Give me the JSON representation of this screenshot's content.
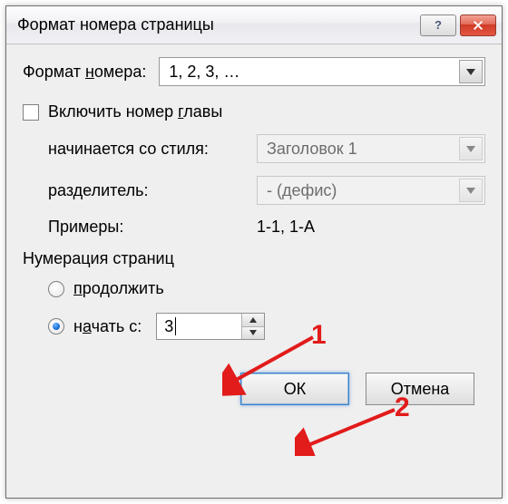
{
  "window": {
    "title": "Формат номера страницы"
  },
  "format_row": {
    "label_pre": "Формат ",
    "label_underline": "н",
    "label_post": "омера:",
    "value": "1, 2, 3, …"
  },
  "include_chapter": {
    "label_pre": "Включить номер ",
    "label_underline": "г",
    "label_post": "лавы",
    "checked": false
  },
  "chapter_style": {
    "label": "начинается со стиля:",
    "value": "Заголовок 1"
  },
  "separator": {
    "label": "разделитель:",
    "value": "-   (дефис)"
  },
  "examples": {
    "label": "Примеры:",
    "value": "1-1, 1-A"
  },
  "numbering": {
    "group_label": "Нумерация страниц",
    "continue": {
      "label_underline": "п",
      "label_post": "родолжить",
      "selected": false
    },
    "start_at": {
      "label_pre": "н",
      "label_mid": "а",
      "label_post": "чать с:",
      "selected": true,
      "value": "3"
    }
  },
  "buttons": {
    "ok": "ОК",
    "cancel": "Отмена"
  },
  "callouts": {
    "one": "1",
    "two": "2"
  }
}
